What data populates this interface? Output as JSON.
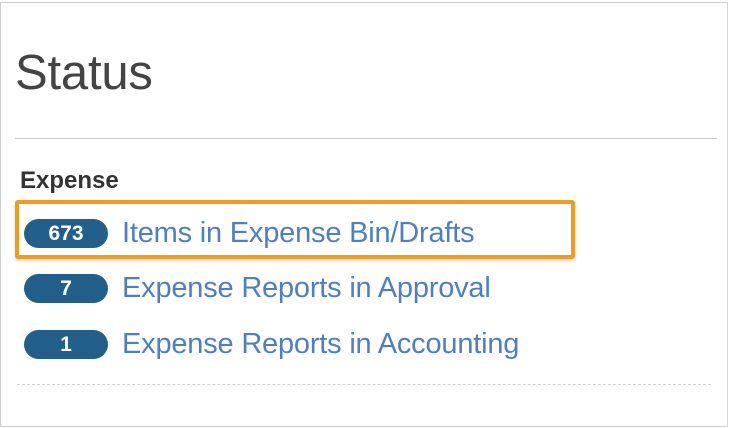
{
  "status_panel": {
    "title": "Status",
    "section": {
      "label": "Expense",
      "items": [
        {
          "count": "673",
          "label": "Items in Expense Bin/Drafts",
          "highlighted": true
        },
        {
          "count": "7",
          "label": "Expense Reports in Approval"
        },
        {
          "count": "1",
          "label": "Expense Reports in Accounting"
        }
      ]
    }
  },
  "colors": {
    "badge_background": "#235f8b",
    "link_text": "#4f7fc2",
    "highlight_border": "#f39c1b",
    "title_text": "#444444"
  }
}
